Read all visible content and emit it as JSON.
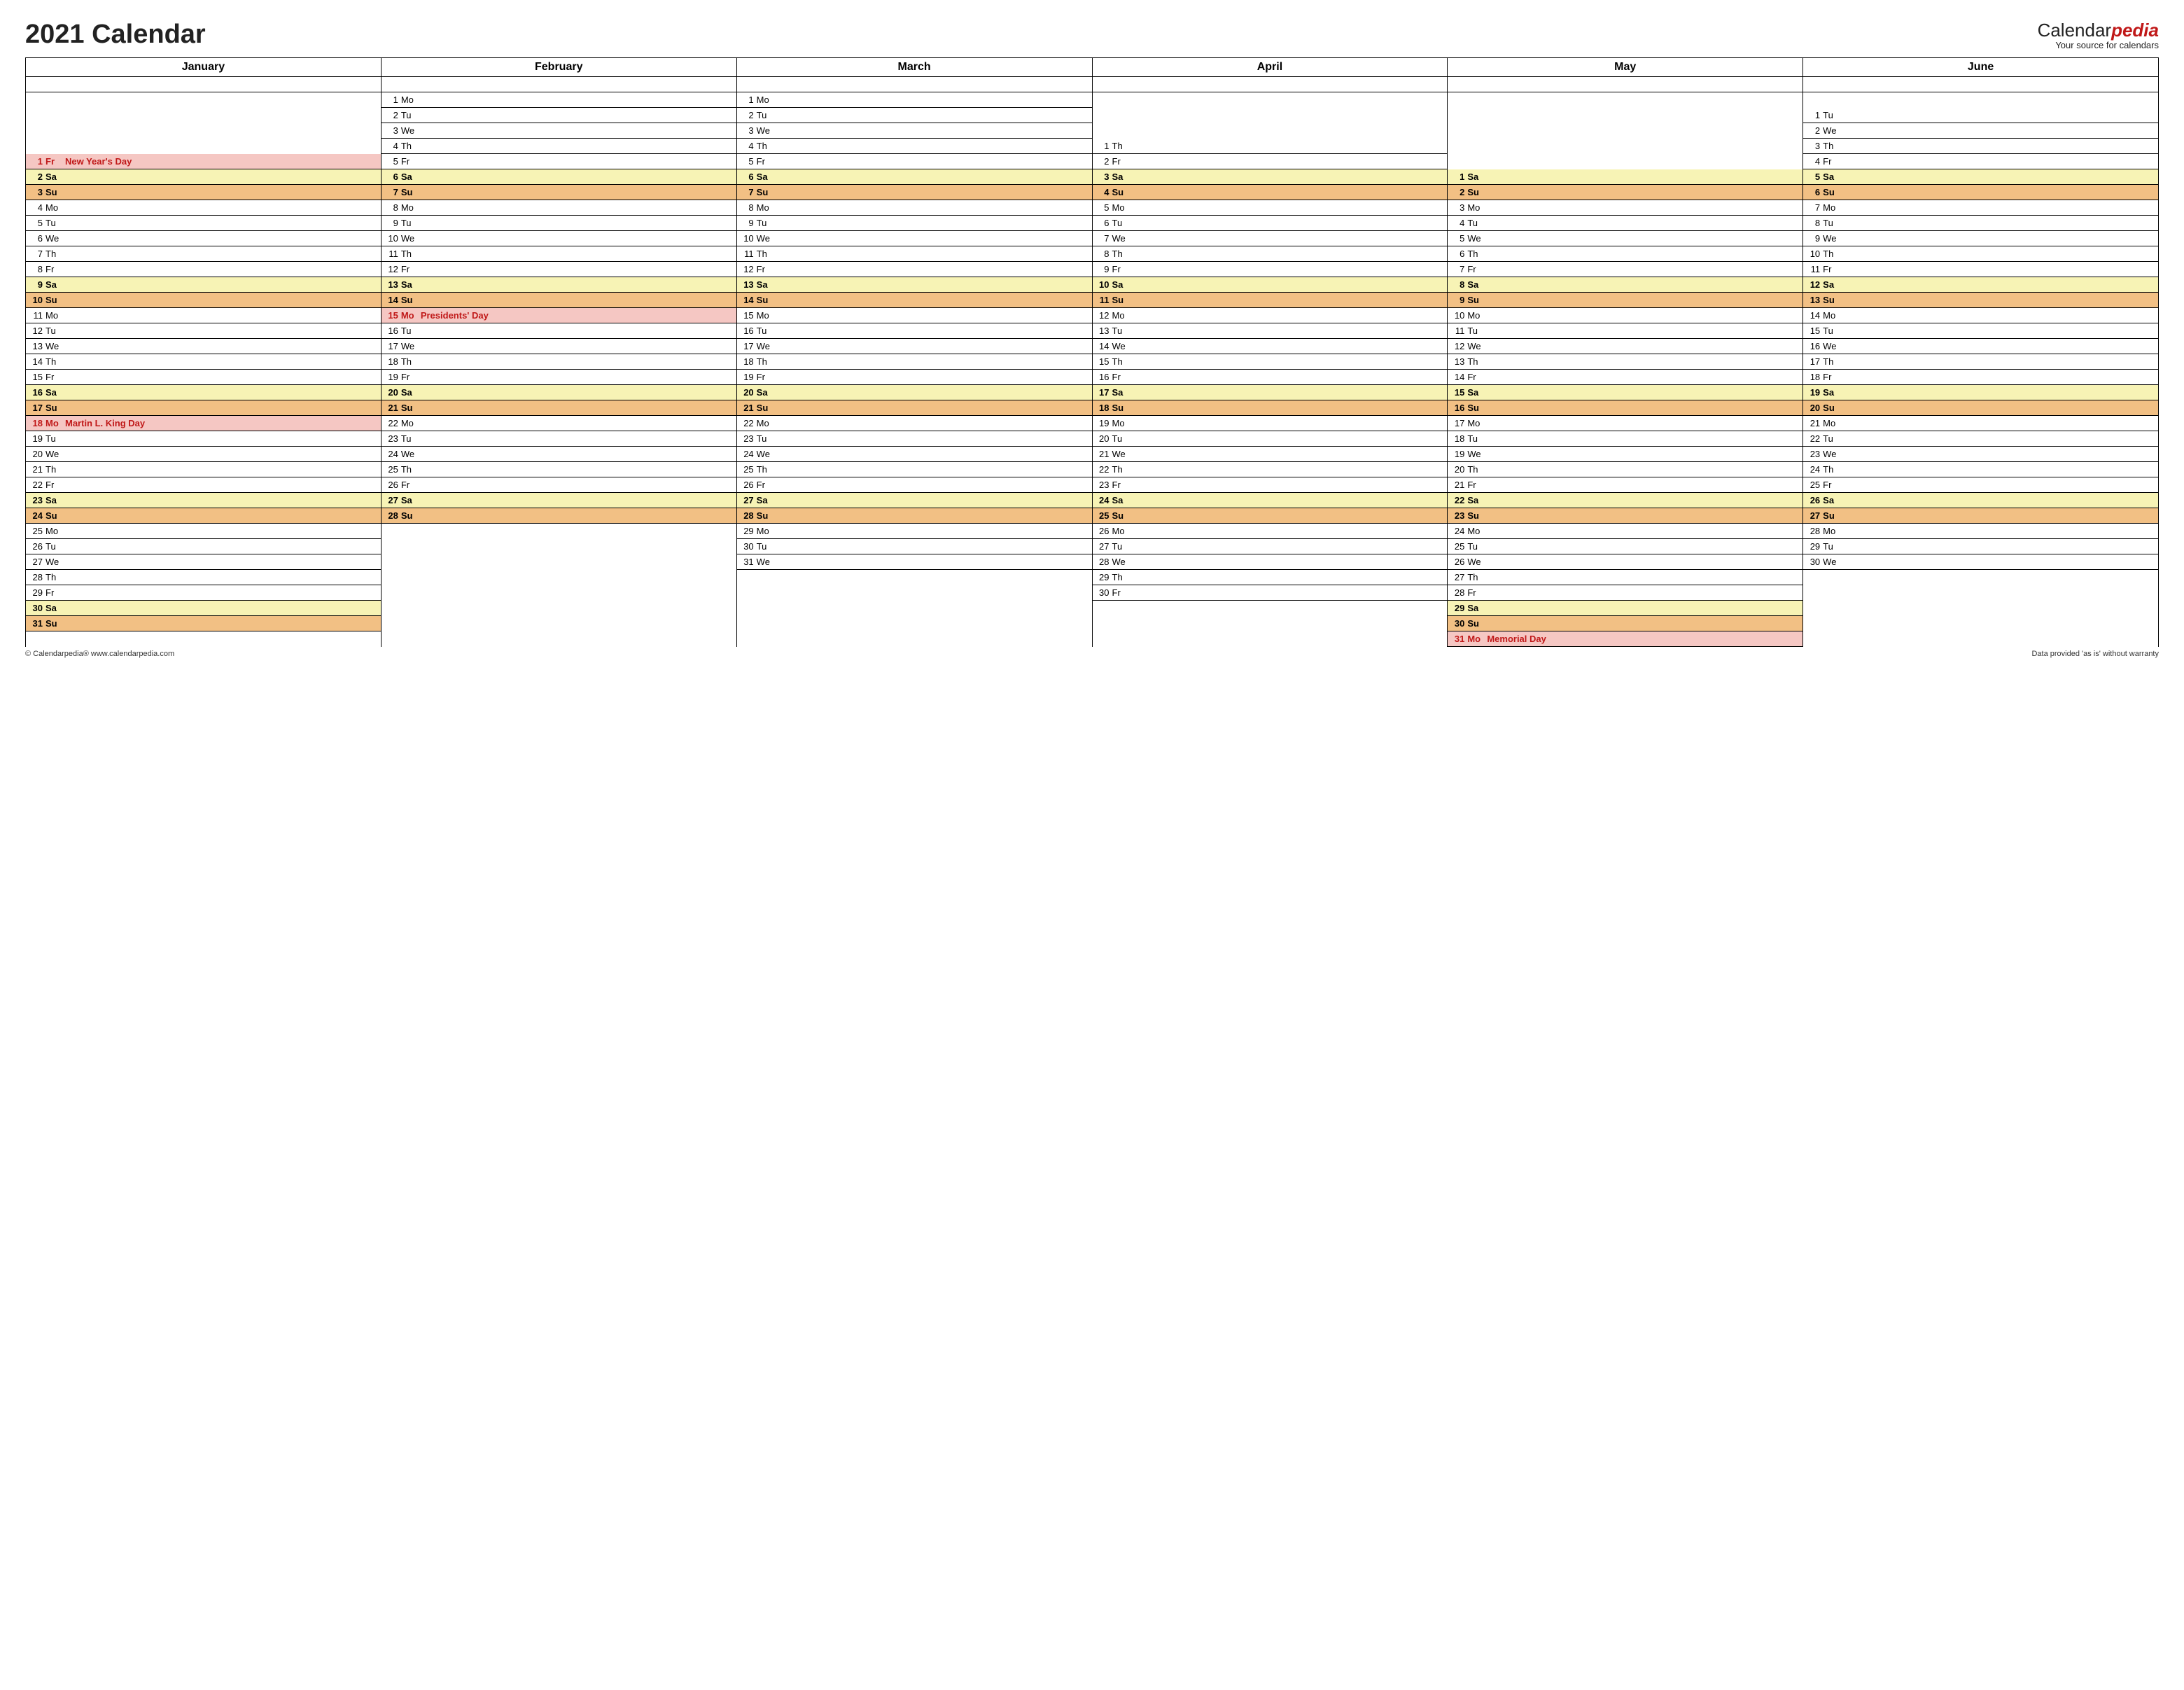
{
  "title": "2021 Calendar",
  "brand": {
    "name": "Calendar",
    "suffix": "pedia",
    "tagline": "Your source for calendars"
  },
  "footer": {
    "left": "© Calendarpedia®   www.calendarpedia.com",
    "right": "Data provided 'as is' without warranty"
  },
  "day_rows": 36,
  "months": [
    {
      "name": "January",
      "offset": 4,
      "days": [
        {
          "n": 1,
          "a": "Fr",
          "t": "holiday",
          "e": "New Year's Day"
        },
        {
          "n": 2,
          "a": "Sa",
          "t": "sat"
        },
        {
          "n": 3,
          "a": "Su",
          "t": "sun"
        },
        {
          "n": 4,
          "a": "Mo"
        },
        {
          "n": 5,
          "a": "Tu"
        },
        {
          "n": 6,
          "a": "We"
        },
        {
          "n": 7,
          "a": "Th"
        },
        {
          "n": 8,
          "a": "Fr"
        },
        {
          "n": 9,
          "a": "Sa",
          "t": "sat"
        },
        {
          "n": 10,
          "a": "Su",
          "t": "sun"
        },
        {
          "n": 11,
          "a": "Mo"
        },
        {
          "n": 12,
          "a": "Tu"
        },
        {
          "n": 13,
          "a": "We"
        },
        {
          "n": 14,
          "a": "Th"
        },
        {
          "n": 15,
          "a": "Fr"
        },
        {
          "n": 16,
          "a": "Sa",
          "t": "sat"
        },
        {
          "n": 17,
          "a": "Su",
          "t": "sun"
        },
        {
          "n": 18,
          "a": "Mo",
          "t": "holiday",
          "e": "Martin L. King Day"
        },
        {
          "n": 19,
          "a": "Tu"
        },
        {
          "n": 20,
          "a": "We"
        },
        {
          "n": 21,
          "a": "Th"
        },
        {
          "n": 22,
          "a": "Fr"
        },
        {
          "n": 23,
          "a": "Sa",
          "t": "sat"
        },
        {
          "n": 24,
          "a": "Su",
          "t": "sun"
        },
        {
          "n": 25,
          "a": "Mo"
        },
        {
          "n": 26,
          "a": "Tu"
        },
        {
          "n": 27,
          "a": "We"
        },
        {
          "n": 28,
          "a": "Th"
        },
        {
          "n": 29,
          "a": "Fr"
        },
        {
          "n": 30,
          "a": "Sa",
          "t": "sat"
        },
        {
          "n": 31,
          "a": "Su",
          "t": "sun"
        }
      ]
    },
    {
      "name": "February",
      "offset": 0,
      "days": [
        {
          "n": 1,
          "a": "Mo"
        },
        {
          "n": 2,
          "a": "Tu"
        },
        {
          "n": 3,
          "a": "We"
        },
        {
          "n": 4,
          "a": "Th"
        },
        {
          "n": 5,
          "a": "Fr"
        },
        {
          "n": 6,
          "a": "Sa",
          "t": "sat"
        },
        {
          "n": 7,
          "a": "Su",
          "t": "sun"
        },
        {
          "n": 8,
          "a": "Mo"
        },
        {
          "n": 9,
          "a": "Tu"
        },
        {
          "n": 10,
          "a": "We"
        },
        {
          "n": 11,
          "a": "Th"
        },
        {
          "n": 12,
          "a": "Fr"
        },
        {
          "n": 13,
          "a": "Sa",
          "t": "sat"
        },
        {
          "n": 14,
          "a": "Su",
          "t": "sun"
        },
        {
          "n": 15,
          "a": "Mo",
          "t": "holiday",
          "e": "Presidents' Day"
        },
        {
          "n": 16,
          "a": "Tu"
        },
        {
          "n": 17,
          "a": "We"
        },
        {
          "n": 18,
          "a": "Th"
        },
        {
          "n": 19,
          "a": "Fr"
        },
        {
          "n": 20,
          "a": "Sa",
          "t": "sat"
        },
        {
          "n": 21,
          "a": "Su",
          "t": "sun"
        },
        {
          "n": 22,
          "a": "Mo"
        },
        {
          "n": 23,
          "a": "Tu"
        },
        {
          "n": 24,
          "a": "We"
        },
        {
          "n": 25,
          "a": "Th"
        },
        {
          "n": 26,
          "a": "Fr"
        },
        {
          "n": 27,
          "a": "Sa",
          "t": "sat"
        },
        {
          "n": 28,
          "a": "Su",
          "t": "sun"
        }
      ]
    },
    {
      "name": "March",
      "offset": 0,
      "days": [
        {
          "n": 1,
          "a": "Mo"
        },
        {
          "n": 2,
          "a": "Tu"
        },
        {
          "n": 3,
          "a": "We"
        },
        {
          "n": 4,
          "a": "Th"
        },
        {
          "n": 5,
          "a": "Fr"
        },
        {
          "n": 6,
          "a": "Sa",
          "t": "sat"
        },
        {
          "n": 7,
          "a": "Su",
          "t": "sun"
        },
        {
          "n": 8,
          "a": "Mo"
        },
        {
          "n": 9,
          "a": "Tu"
        },
        {
          "n": 10,
          "a": "We"
        },
        {
          "n": 11,
          "a": "Th"
        },
        {
          "n": 12,
          "a": "Fr"
        },
        {
          "n": 13,
          "a": "Sa",
          "t": "sat"
        },
        {
          "n": 14,
          "a": "Su",
          "t": "sun"
        },
        {
          "n": 15,
          "a": "Mo"
        },
        {
          "n": 16,
          "a": "Tu"
        },
        {
          "n": 17,
          "a": "We"
        },
        {
          "n": 18,
          "a": "Th"
        },
        {
          "n": 19,
          "a": "Fr"
        },
        {
          "n": 20,
          "a": "Sa",
          "t": "sat"
        },
        {
          "n": 21,
          "a": "Su",
          "t": "sun"
        },
        {
          "n": 22,
          "a": "Mo"
        },
        {
          "n": 23,
          "a": "Tu"
        },
        {
          "n": 24,
          "a": "We"
        },
        {
          "n": 25,
          "a": "Th"
        },
        {
          "n": 26,
          "a": "Fr"
        },
        {
          "n": 27,
          "a": "Sa",
          "t": "sat"
        },
        {
          "n": 28,
          "a": "Su",
          "t": "sun"
        },
        {
          "n": 29,
          "a": "Mo"
        },
        {
          "n": 30,
          "a": "Tu"
        },
        {
          "n": 31,
          "a": "We"
        }
      ]
    },
    {
      "name": "April",
      "offset": 3,
      "days": [
        {
          "n": 1,
          "a": "Th"
        },
        {
          "n": 2,
          "a": "Fr"
        },
        {
          "n": 3,
          "a": "Sa",
          "t": "sat"
        },
        {
          "n": 4,
          "a": "Su",
          "t": "sun"
        },
        {
          "n": 5,
          "a": "Mo"
        },
        {
          "n": 6,
          "a": "Tu"
        },
        {
          "n": 7,
          "a": "We"
        },
        {
          "n": 8,
          "a": "Th"
        },
        {
          "n": 9,
          "a": "Fr"
        },
        {
          "n": 10,
          "a": "Sa",
          "t": "sat"
        },
        {
          "n": 11,
          "a": "Su",
          "t": "sun"
        },
        {
          "n": 12,
          "a": "Mo"
        },
        {
          "n": 13,
          "a": "Tu"
        },
        {
          "n": 14,
          "a": "We"
        },
        {
          "n": 15,
          "a": "Th"
        },
        {
          "n": 16,
          "a": "Fr"
        },
        {
          "n": 17,
          "a": "Sa",
          "t": "sat"
        },
        {
          "n": 18,
          "a": "Su",
          "t": "sun"
        },
        {
          "n": 19,
          "a": "Mo"
        },
        {
          "n": 20,
          "a": "Tu"
        },
        {
          "n": 21,
          "a": "We"
        },
        {
          "n": 22,
          "a": "Th"
        },
        {
          "n": 23,
          "a": "Fr"
        },
        {
          "n": 24,
          "a": "Sa",
          "t": "sat"
        },
        {
          "n": 25,
          "a": "Su",
          "t": "sun"
        },
        {
          "n": 26,
          "a": "Mo"
        },
        {
          "n": 27,
          "a": "Tu"
        },
        {
          "n": 28,
          "a": "We"
        },
        {
          "n": 29,
          "a": "Th"
        },
        {
          "n": 30,
          "a": "Fr"
        }
      ]
    },
    {
      "name": "May",
      "offset": 5,
      "days": [
        {
          "n": 1,
          "a": "Sa",
          "t": "sat"
        },
        {
          "n": 2,
          "a": "Su",
          "t": "sun"
        },
        {
          "n": 3,
          "a": "Mo"
        },
        {
          "n": 4,
          "a": "Tu"
        },
        {
          "n": 5,
          "a": "We"
        },
        {
          "n": 6,
          "a": "Th"
        },
        {
          "n": 7,
          "a": "Fr"
        },
        {
          "n": 8,
          "a": "Sa",
          "t": "sat"
        },
        {
          "n": 9,
          "a": "Su",
          "t": "sun"
        },
        {
          "n": 10,
          "a": "Mo"
        },
        {
          "n": 11,
          "a": "Tu"
        },
        {
          "n": 12,
          "a": "We"
        },
        {
          "n": 13,
          "a": "Th"
        },
        {
          "n": 14,
          "a": "Fr"
        },
        {
          "n": 15,
          "a": "Sa",
          "t": "sat"
        },
        {
          "n": 16,
          "a": "Su",
          "t": "sun"
        },
        {
          "n": 17,
          "a": "Mo"
        },
        {
          "n": 18,
          "a": "Tu"
        },
        {
          "n": 19,
          "a": "We"
        },
        {
          "n": 20,
          "a": "Th"
        },
        {
          "n": 21,
          "a": "Fr"
        },
        {
          "n": 22,
          "a": "Sa",
          "t": "sat"
        },
        {
          "n": 23,
          "a": "Su",
          "t": "sun"
        },
        {
          "n": 24,
          "a": "Mo"
        },
        {
          "n": 25,
          "a": "Tu"
        },
        {
          "n": 26,
          "a": "We"
        },
        {
          "n": 27,
          "a": "Th"
        },
        {
          "n": 28,
          "a": "Fr"
        },
        {
          "n": 29,
          "a": "Sa",
          "t": "sat"
        },
        {
          "n": 30,
          "a": "Su",
          "t": "sun"
        },
        {
          "n": 31,
          "a": "Mo",
          "t": "holiday",
          "e": "Memorial Day"
        }
      ]
    },
    {
      "name": "June",
      "offset": 1,
      "days": [
        {
          "n": 1,
          "a": "Tu"
        },
        {
          "n": 2,
          "a": "We"
        },
        {
          "n": 3,
          "a": "Th"
        },
        {
          "n": 4,
          "a": "Fr"
        },
        {
          "n": 5,
          "a": "Sa",
          "t": "sat"
        },
        {
          "n": 6,
          "a": "Su",
          "t": "sun"
        },
        {
          "n": 7,
          "a": "Mo"
        },
        {
          "n": 8,
          "a": "Tu"
        },
        {
          "n": 9,
          "a": "We"
        },
        {
          "n": 10,
          "a": "Th"
        },
        {
          "n": 11,
          "a": "Fr"
        },
        {
          "n": 12,
          "a": "Sa",
          "t": "sat"
        },
        {
          "n": 13,
          "a": "Su",
          "t": "sun"
        },
        {
          "n": 14,
          "a": "Mo"
        },
        {
          "n": 15,
          "a": "Tu"
        },
        {
          "n": 16,
          "a": "We"
        },
        {
          "n": 17,
          "a": "Th"
        },
        {
          "n": 18,
          "a": "Fr"
        },
        {
          "n": 19,
          "a": "Sa",
          "t": "sat"
        },
        {
          "n": 20,
          "a": "Su",
          "t": "sun"
        },
        {
          "n": 21,
          "a": "Mo"
        },
        {
          "n": 22,
          "a": "Tu"
        },
        {
          "n": 23,
          "a": "We"
        },
        {
          "n": 24,
          "a": "Th"
        },
        {
          "n": 25,
          "a": "Fr"
        },
        {
          "n": 26,
          "a": "Sa",
          "t": "sat"
        },
        {
          "n": 27,
          "a": "Su",
          "t": "sun"
        },
        {
          "n": 28,
          "a": "Mo"
        },
        {
          "n": 29,
          "a": "Tu"
        },
        {
          "n": 30,
          "a": "We"
        }
      ]
    }
  ]
}
